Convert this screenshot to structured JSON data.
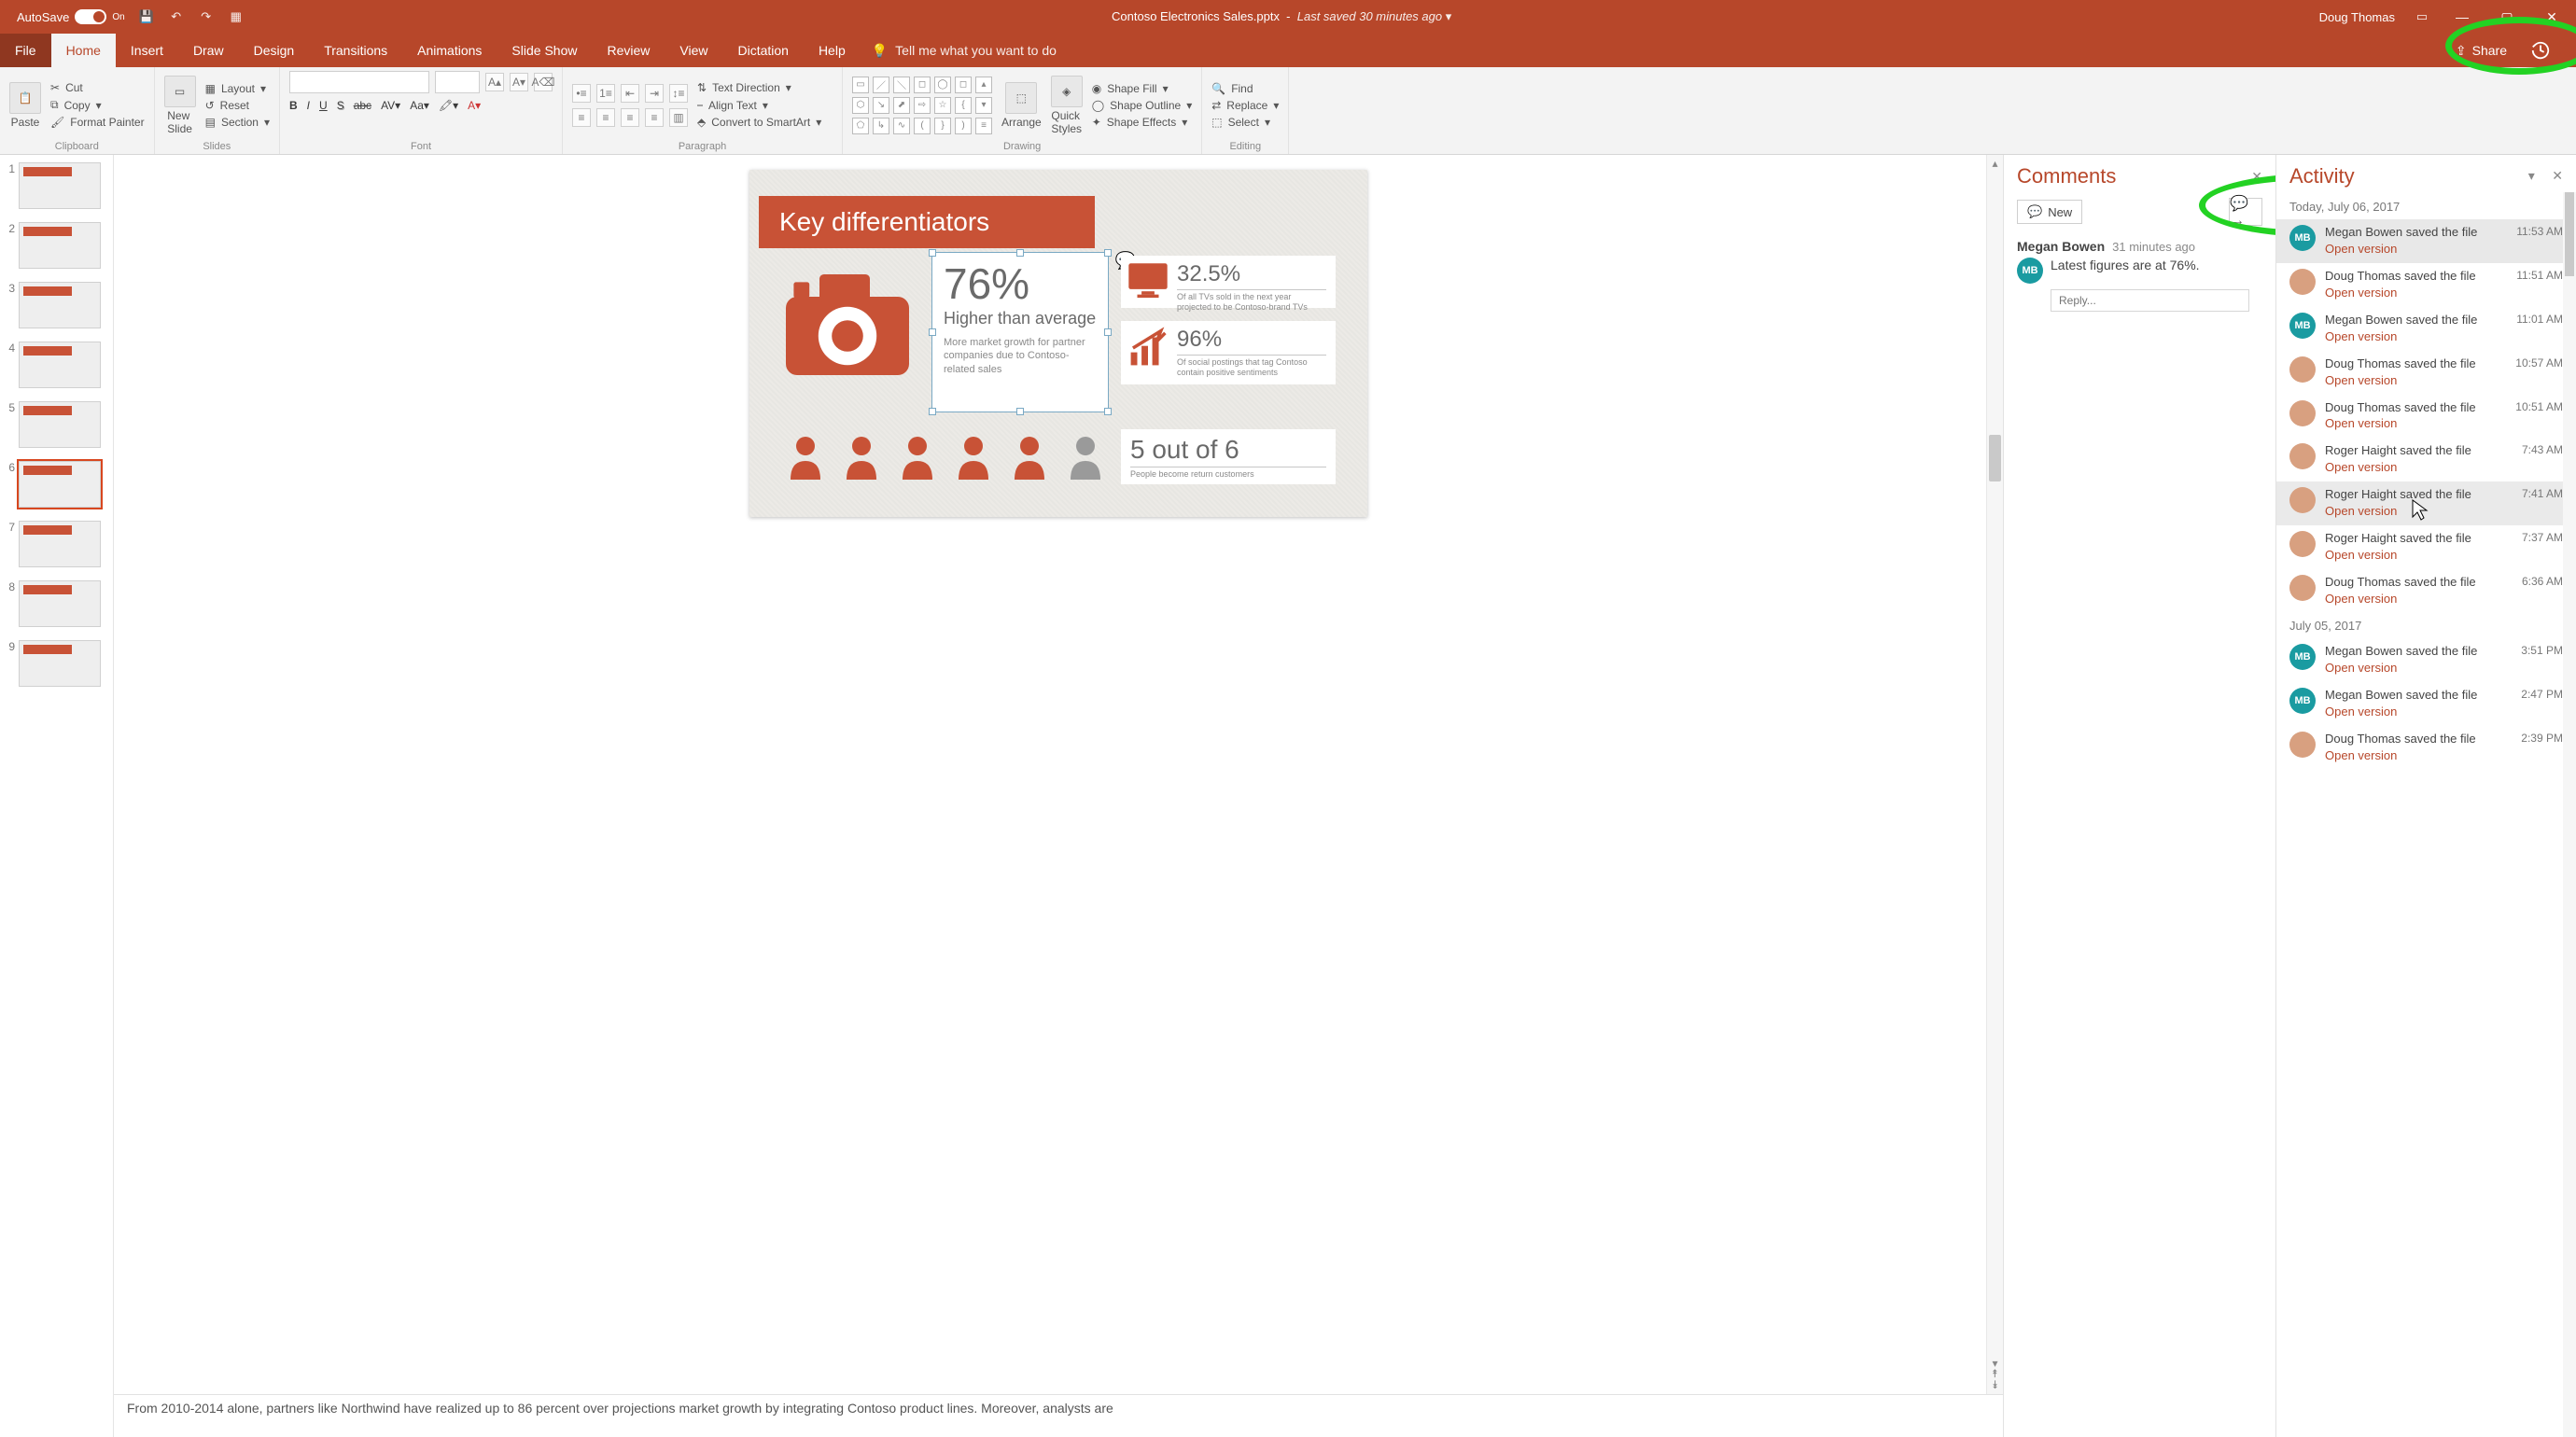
{
  "titlebar": {
    "autosave_label": "AutoSave",
    "autosave_state": "On",
    "filename": "Contoso Electronics Sales.pptx",
    "saved_status": "Last saved 30 minutes ago",
    "user": "Doug Thomas"
  },
  "tabs": {
    "file": "File",
    "home": "Home",
    "insert": "Insert",
    "draw": "Draw",
    "design": "Design",
    "transitions": "Transitions",
    "animations": "Animations",
    "slideshow": "Slide Show",
    "review": "Review",
    "view": "View",
    "dictation": "Dictation",
    "help": "Help",
    "tellme": "Tell me what you want to do",
    "share": "Share"
  },
  "ribbon": {
    "clipboard": {
      "paste": "Paste",
      "cut": "Cut",
      "copy": "Copy",
      "format_painter": "Format Painter",
      "label": "Clipboard"
    },
    "slides": {
      "new_slide": "New\nSlide",
      "layout": "Layout",
      "reset": "Reset",
      "section": "Section",
      "label": "Slides"
    },
    "font": {
      "label": "Font"
    },
    "paragraph": {
      "text_direction": "Text Direction",
      "align_text": "Align Text",
      "smartart": "Convert to SmartArt",
      "label": "Paragraph"
    },
    "drawing": {
      "arrange": "Arrange",
      "quick_styles": "Quick\nStyles",
      "shape_fill": "Shape Fill",
      "shape_outline": "Shape Outline",
      "shape_effects": "Shape Effects",
      "label": "Drawing"
    },
    "editing": {
      "find": "Find",
      "replace": "Replace",
      "select": "Select",
      "label": "Editing"
    }
  },
  "thumbnails": [
    1,
    2,
    3,
    4,
    5,
    6,
    7,
    8,
    9
  ],
  "selected_thumb": 6,
  "slide": {
    "title": "Key differentiators",
    "main_stat": "76%",
    "main_sub": "Higher than average",
    "main_desc": "More market growth for partner companies due to Contoso-related sales",
    "s1_num": "32.5%",
    "s1_desc": "Of all TVs sold in the next year projected to be Contoso-brand TVs",
    "s2_num": "96%",
    "s2_desc": "Of social postings that tag Contoso contain positive sentiments",
    "ratio_num": "5 out of 6",
    "ratio_desc": "People become return customers"
  },
  "notes": "From 2010-2014 alone, partners like Northwind have realized up to 86 percent over projections market growth by integrating Contoso product lines. Moreover, analysts are",
  "comments": {
    "title": "Comments",
    "new": "New",
    "author": "Megan Bowen",
    "time": "31 minutes ago",
    "text": "Latest figures are at 76%.",
    "reply_ph": "Reply..."
  },
  "activity": {
    "title": "Activity",
    "dates": {
      "today": "Today, July 06, 2017",
      "yesterday": "July 05, 2017"
    },
    "open": "Open version",
    "items_today": [
      {
        "user": "Megan Bowen",
        "action": "saved the file",
        "time": "11:53 AM",
        "avatar": "MB",
        "hl": true
      },
      {
        "user": "Doug Thomas",
        "action": "saved the file",
        "time": "11:51 AM",
        "avatar": "photo"
      },
      {
        "user": "Megan Bowen",
        "action": "saved the file",
        "time": "11:01 AM",
        "avatar": "MB"
      },
      {
        "user": "Doug Thomas",
        "action": "saved the file",
        "time": "10:57 AM",
        "avatar": "photo"
      },
      {
        "user": "Doug Thomas",
        "action": "saved the file",
        "time": "10:51 AM",
        "avatar": "photo"
      },
      {
        "user": "Roger Haight",
        "action": "saved the file",
        "time": "7:43 AM",
        "avatar": "photo"
      },
      {
        "user": "Roger Haight",
        "action": "saved the file",
        "time": "7:41 AM",
        "avatar": "photo",
        "hover": true
      },
      {
        "user": "Roger Haight",
        "action": "saved the file",
        "time": "7:37 AM",
        "avatar": "photo"
      },
      {
        "user": "Doug Thomas",
        "action": "saved the file",
        "time": "6:36 AM",
        "avatar": "photo"
      }
    ],
    "items_yesterday": [
      {
        "user": "Megan Bowen",
        "action": "saved the file",
        "time": "3:51 PM",
        "avatar": "MB"
      },
      {
        "user": "Megan Bowen",
        "action": "saved the file",
        "time": "2:47 PM",
        "avatar": "MB"
      },
      {
        "user": "Doug Thomas",
        "action": "saved the file",
        "time": "2:39 PM",
        "avatar": "photo"
      }
    ]
  }
}
